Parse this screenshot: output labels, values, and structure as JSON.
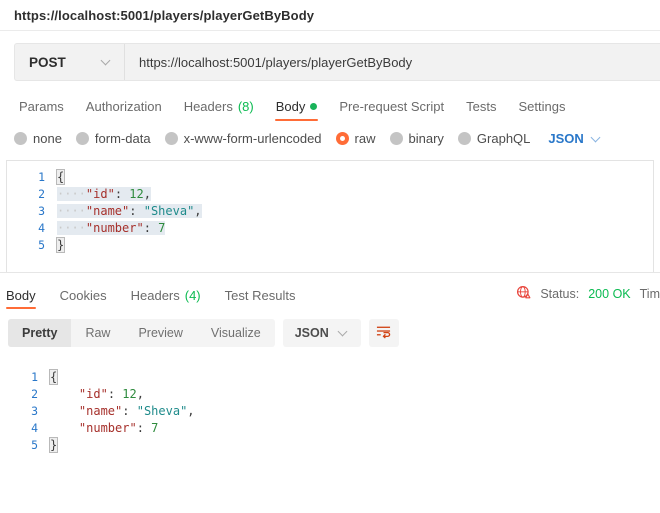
{
  "titlebar": {
    "request_title": "https://localhost:5001/players/playerGetByBody"
  },
  "url_bar": {
    "method": "POST",
    "method_chevron_icon": "chevron-down-icon",
    "url": "https://localhost:5001/players/playerGetByBody"
  },
  "request_tabs": [
    {
      "label": "Params",
      "active": false
    },
    {
      "label": "Authorization",
      "active": false
    },
    {
      "label": "Headers",
      "count": "(8)",
      "active": false
    },
    {
      "label": "Body",
      "active": true,
      "dot": "green"
    },
    {
      "label": "Pre-request Script",
      "active": false
    },
    {
      "label": "Tests",
      "active": false
    },
    {
      "label": "Settings",
      "active": false
    }
  ],
  "body_types": [
    {
      "label": "none",
      "selected": false
    },
    {
      "label": "form-data",
      "selected": false
    },
    {
      "label": "x-www-form-urlencoded",
      "selected": false
    },
    {
      "label": "raw",
      "selected": true
    },
    {
      "label": "binary",
      "selected": false
    },
    {
      "label": "GraphQL",
      "selected": false
    }
  ],
  "body_language": {
    "label": "JSON",
    "chevron_icon": "chevron-down-icon"
  },
  "request_editor": {
    "lines": [
      {
        "n": "1",
        "segments": [
          {
            "t": "{",
            "c": "k-brace hl"
          }
        ]
      },
      {
        "n": "2",
        "selected": true,
        "segments": [
          {
            "t": "····",
            "c": "ws"
          },
          {
            "t": "\"id\"",
            "c": "k-key"
          },
          {
            "t": ": ",
            "c": "k-pun"
          },
          {
            "t": "12",
            "c": "k-num"
          },
          {
            "t": ",",
            "c": "k-pun"
          }
        ]
      },
      {
        "n": "3",
        "selected": true,
        "segments": [
          {
            "t": "····",
            "c": "ws"
          },
          {
            "t": "\"name\"",
            "c": "k-key"
          },
          {
            "t": ": ",
            "c": "k-pun"
          },
          {
            "t": "\"Sheva\"",
            "c": "k-str"
          },
          {
            "t": ",",
            "c": "k-pun"
          }
        ]
      },
      {
        "n": "4",
        "selected": true,
        "segments": [
          {
            "t": "····",
            "c": "ws"
          },
          {
            "t": "\"number\"",
            "c": "k-key"
          },
          {
            "t": ": ",
            "c": "k-pun"
          },
          {
            "t": "7",
            "c": "k-num"
          }
        ]
      },
      {
        "n": "5",
        "segments": [
          {
            "t": "}",
            "c": "k-brace hl"
          }
        ]
      }
    ]
  },
  "response_tabs": [
    {
      "label": "Body",
      "active": true
    },
    {
      "label": "Cookies",
      "active": false
    },
    {
      "label": "Headers",
      "count": "(4)",
      "active": false
    },
    {
      "label": "Test Results",
      "active": false
    }
  ],
  "response_status": {
    "globe_icon": "globe-warning-icon",
    "status_label": "Status:",
    "status_value": "200 OK",
    "time_label": "Tim"
  },
  "response_toolbar": {
    "views": [
      {
        "label": "Pretty",
        "active": true
      },
      {
        "label": "Raw",
        "active": false
      },
      {
        "label": "Preview",
        "active": false
      },
      {
        "label": "Visualize",
        "active": false
      }
    ],
    "language": {
      "label": "JSON",
      "chevron_icon": "chevron-down-icon"
    },
    "wrap_button_icon": "word-wrap-icon"
  },
  "response_editor": {
    "lines": [
      {
        "n": "1",
        "segments": [
          {
            "t": "{",
            "c": "k-brace hl"
          }
        ]
      },
      {
        "n": "2",
        "segments": [
          {
            "t": "    ",
            "c": "k-pun"
          },
          {
            "t": "\"id\"",
            "c": "k-key"
          },
          {
            "t": ": ",
            "c": "k-pun"
          },
          {
            "t": "12",
            "c": "k-num"
          },
          {
            "t": ",",
            "c": "k-pun"
          }
        ]
      },
      {
        "n": "3",
        "segments": [
          {
            "t": "    ",
            "c": "k-pun"
          },
          {
            "t": "\"name\"",
            "c": "k-key"
          },
          {
            "t": ": ",
            "c": "k-pun"
          },
          {
            "t": "\"Sheva\"",
            "c": "k-str"
          },
          {
            "t": ",",
            "c": "k-pun"
          }
        ]
      },
      {
        "n": "4",
        "segments": [
          {
            "t": "    ",
            "c": "k-pun"
          },
          {
            "t": "\"number\"",
            "c": "k-key"
          },
          {
            "t": ": ",
            "c": "k-pun"
          },
          {
            "t": "7",
            "c": "k-num"
          }
        ]
      },
      {
        "n": "5",
        "segments": [
          {
            "t": "}",
            "c": "k-brace hl"
          }
        ]
      }
    ]
  },
  "colors": {
    "accent": "#ff6c37",
    "link": "#2977c9",
    "success": "#0cbb52",
    "error": "#e8453c"
  }
}
